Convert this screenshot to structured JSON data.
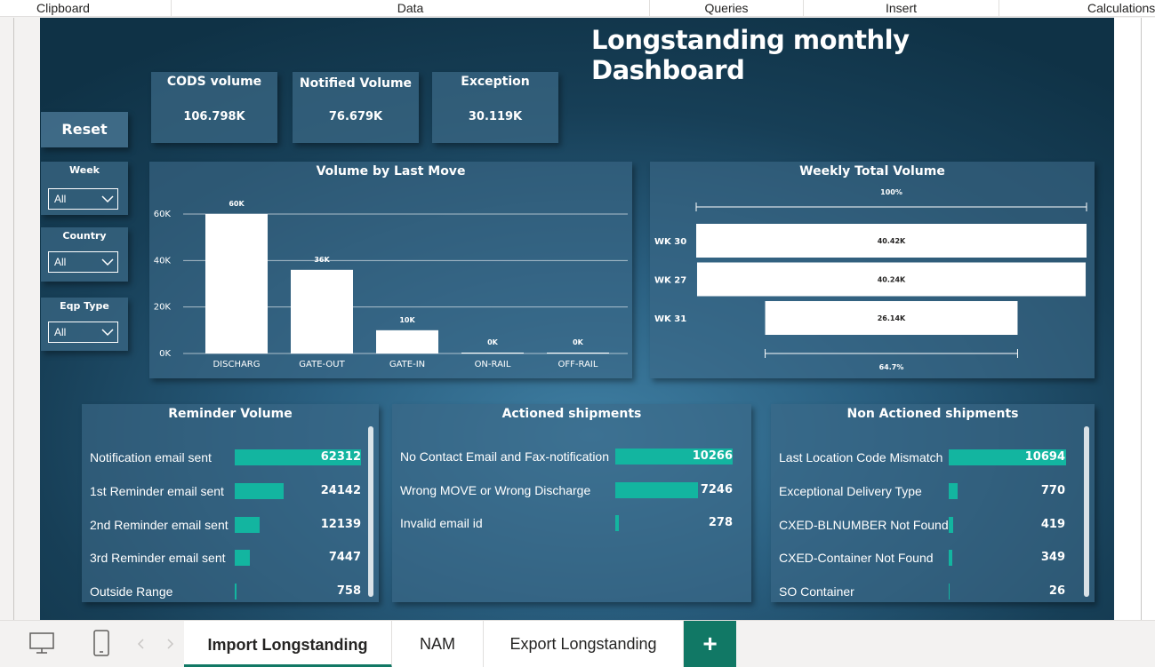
{
  "ribbon": {
    "groups": [
      "Clipboard",
      "Data",
      "Queries",
      "Insert",
      "Calculations"
    ]
  },
  "dashboard": {
    "title": "Longstanding monthly Dashboard"
  },
  "kpis": [
    {
      "label": "CODS volume",
      "value": "106.798K"
    },
    {
      "label": "Notified Volume",
      "value": "76.679K"
    },
    {
      "label": "Exception",
      "value": "30.119K"
    }
  ],
  "reset": {
    "label": "Reset"
  },
  "slicers": [
    {
      "label": "Week",
      "value": "All"
    },
    {
      "label": "Country",
      "value": "All"
    },
    {
      "label": "Eqp Type",
      "value": "All"
    }
  ],
  "volume_chart": {
    "title": "Volume by Last Move"
  },
  "weekly_chart": {
    "title": "Weekly Total Volume"
  },
  "chart_data": [
    {
      "type": "bar",
      "title": "Volume by Last Move",
      "categories": [
        "DISCHARG",
        "GATE-OUT",
        "GATE-IN",
        "ON-RAIL",
        "OFF-RAIL"
      ],
      "values": [
        60000,
        36000,
        10000,
        0,
        0
      ],
      "data_labels": [
        "60K",
        "36K",
        "10K",
        "0K",
        "0K"
      ],
      "ylim": [
        0,
        60000
      ],
      "yticks": [
        "0K",
        "20K",
        "40K",
        "60K"
      ],
      "grid": true
    },
    {
      "type": "bar",
      "orientation": "horizontal funnel",
      "title": "Weekly Total Volume",
      "categories": [
        "WK 30",
        "WK 27",
        "WK 31"
      ],
      "values": [
        40.42,
        40.24,
        26.14
      ],
      "data_labels": [
        "40.42K",
        "40.24K",
        "26.14K"
      ],
      "top_label": "100%",
      "bottom_label": "64.7%"
    }
  ],
  "reminder": {
    "title": "Reminder Volume",
    "max": 62312,
    "rows": [
      {
        "label": "Notification email sent",
        "value": "62312",
        "num": 62312
      },
      {
        "label": "1st Reminder email sent",
        "value": "24142",
        "num": 24142
      },
      {
        "label": "2nd Reminder email sent",
        "value": "12139",
        "num": 12139
      },
      {
        "label": "3rd Reminder email sent",
        "value": "7447",
        "num": 7447
      },
      {
        "label": "Outside Range",
        "value": "758",
        "num": 758
      }
    ]
  },
  "actioned": {
    "title": "Actioned shipments",
    "max": 10266,
    "rows": [
      {
        "label": "No Contact Email and Fax-notification",
        "value": "10266",
        "num": 10266
      },
      {
        "label": "Wrong MOVE or Wrong Discharge",
        "value": "7246",
        "num": 7246
      },
      {
        "label": "Invalid email id",
        "value": "278",
        "num": 278
      }
    ]
  },
  "non_actioned": {
    "title": "Non Actioned shipments",
    "max": 10694,
    "rows": [
      {
        "label": "Last Location Code Mismatch",
        "value": "10694",
        "num": 10694
      },
      {
        "label": "Exceptional Delivery Type",
        "value": "770",
        "num": 770
      },
      {
        "label": "CXED-BLNUMBER Not Found",
        "value": "419",
        "num": 419
      },
      {
        "label": "CXED-Container Not Found",
        "value": "349",
        "num": 349
      },
      {
        "label": "SO Container",
        "value": "26",
        "num": 26
      }
    ]
  },
  "tabs": {
    "items": [
      "Import Longstanding",
      "NAM",
      "Export Longstanding"
    ],
    "active": "Import Longstanding",
    "add_label": "+"
  },
  "colors": {
    "bar_teal": "#13b5a0",
    "tab_accent": "#117865",
    "canvas_dark": "#0f3246"
  }
}
